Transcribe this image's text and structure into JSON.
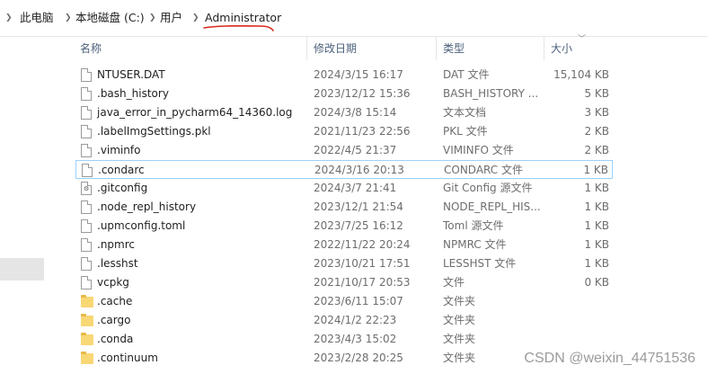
{
  "breadcrumb": {
    "items": [
      "此电脑",
      "本地磁盘 (C:)",
      "用户",
      "Administrator"
    ]
  },
  "columns": {
    "name": "名称",
    "date": "修改日期",
    "type": "类型",
    "size": "大小"
  },
  "files": [
    {
      "name": "NTUSER.DAT",
      "date": "2024/3/15 16:17",
      "type": "DAT 文件",
      "size": "15,104 KB",
      "icon": "file-icon"
    },
    {
      "name": ".bash_history",
      "date": "2023/12/12 15:36",
      "type": "BASH_HISTORY ...",
      "size": "5 KB",
      "icon": "file-icon"
    },
    {
      "name": "java_error_in_pycharm64_14360.log",
      "date": "2024/3/8 15:14",
      "type": "文本文档",
      "size": "3 KB",
      "icon": "text-file-icon"
    },
    {
      "name": ".labelImgSettings.pkl",
      "date": "2021/11/23 22:56",
      "type": "PKL 文件",
      "size": "2 KB",
      "icon": "file-icon"
    },
    {
      "name": ".viminfo",
      "date": "2022/4/5 21:37",
      "type": "VIMINFO 文件",
      "size": "2 KB",
      "icon": "file-icon"
    },
    {
      "name": ".condarc",
      "date": "2024/3/16 20:13",
      "type": "CONDARC 文件",
      "size": "1 KB",
      "icon": "file-icon"
    },
    {
      "name": ".gitconfig",
      "date": "2024/3/7 21:41",
      "type": "Git Config 源文件",
      "size": "1 KB",
      "icon": "gear-file-icon"
    },
    {
      "name": ".node_repl_history",
      "date": "2023/12/1 21:54",
      "type": "NODE_REPL_HIS...",
      "size": "1 KB",
      "icon": "file-icon"
    },
    {
      "name": ".upmconfig.toml",
      "date": "2023/7/25 16:12",
      "type": "Toml 源文件",
      "size": "1 KB",
      "icon": "file-icon"
    },
    {
      "name": ".npmrc",
      "date": "2022/11/22 20:24",
      "type": "NPMRC 文件",
      "size": "1 KB",
      "icon": "file-icon"
    },
    {
      "name": ".lesshst",
      "date": "2023/10/21 17:51",
      "type": "LESSHST 文件",
      "size": "1 KB",
      "icon": "file-icon"
    },
    {
      "name": "vcpkg",
      "date": "2021/10/17 20:53",
      "type": "文件",
      "size": "0 KB",
      "icon": "file-icon"
    },
    {
      "name": ".cache",
      "date": "2023/6/11 15:07",
      "type": "文件夹",
      "size": "",
      "icon": "folder-icon"
    },
    {
      "name": ".cargo",
      "date": "2024/1/2 22:23",
      "type": "文件夹",
      "size": "",
      "icon": "folder-icon"
    },
    {
      "name": ".conda",
      "date": "2023/4/3 15:02",
      "type": "文件夹",
      "size": "",
      "icon": "folder-icon"
    },
    {
      "name": ".continuum",
      "date": "2023/2/28 20:25",
      "type": "文件夹",
      "size": "",
      "icon": "folder-icon"
    }
  ],
  "selected_index": 5,
  "watermark": "CSDN @weixin_44751536",
  "colors": {
    "annotation_underline": "#d9281c",
    "selection_border": "#99d1ff",
    "folder": "#f8d775"
  }
}
